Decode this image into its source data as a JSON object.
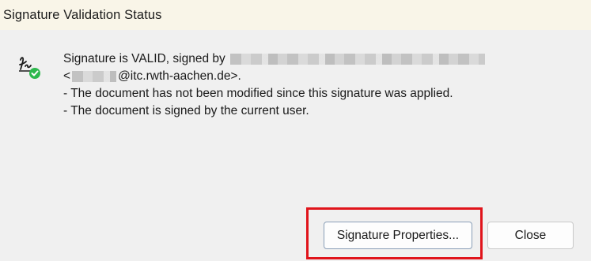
{
  "window": {
    "title": "Signature Validation Status"
  },
  "message": {
    "line1_prefix": "Signature is VALID, signed by",
    "line2_open": "<",
    "line2_suffix": "@itc.rwth-aachen.de>.",
    "line3": "- The document has not been modified since this signature was applied.",
    "line4": "- The document is signed by the current user."
  },
  "icons": {
    "status_icon": "signature-valid-icon",
    "accent_color": "#2db84d"
  },
  "buttons": {
    "properties_label": "Signature Properties...",
    "close_label": "Close"
  },
  "annotation": {
    "highlight_color": "#e0141b"
  }
}
